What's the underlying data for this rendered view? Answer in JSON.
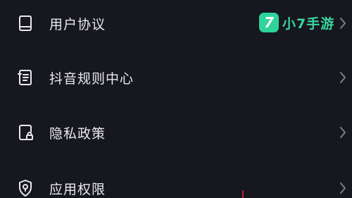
{
  "menu": {
    "items": [
      {
        "label": "用户协议",
        "icon": "book-icon"
      },
      {
        "label": "抖音规则中心",
        "icon": "document-list-icon"
      },
      {
        "label": "隐私政策",
        "icon": "lock-document-icon"
      },
      {
        "label": "应用权限",
        "icon": "shield-location-icon"
      }
    ]
  },
  "watermark": {
    "badge": "7",
    "text": "小7手游"
  },
  "colors": {
    "background": "#16171f",
    "text": "#e9e9ee",
    "chevron": "#7d7e86",
    "watermark_green": "#2fd39b"
  }
}
